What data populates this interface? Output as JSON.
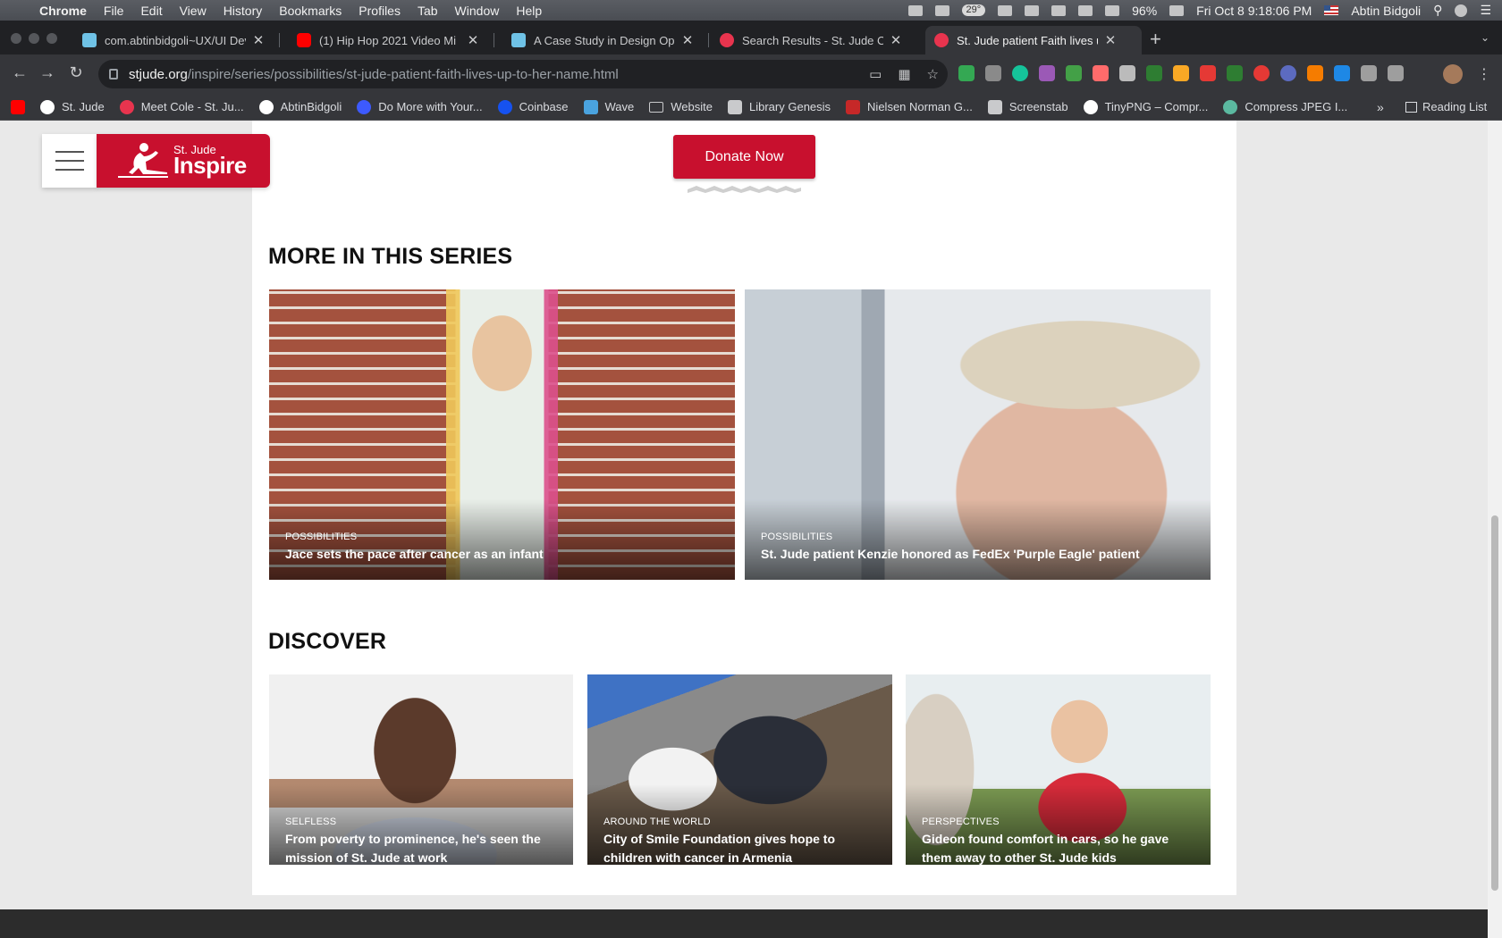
{
  "menubar": {
    "app": "Chrome",
    "items": [
      "File",
      "Edit",
      "View",
      "History",
      "Bookmarks",
      "Profiles",
      "Tab",
      "Window",
      "Help"
    ],
    "temperature": "29°",
    "battery": "96%",
    "datetime": "Fri Oct 8  9:18:06 PM",
    "user": "Abtin Bidgoli"
  },
  "tabs": [
    {
      "title": "com.abtinbidgoli~UX/UI Devel",
      "favicon": "site-icon",
      "color": "#6fc2e6"
    },
    {
      "title": "(1) Hip Hop 2021 Video Mi",
      "favicon": "youtube-icon",
      "color": "#ff0000"
    },
    {
      "title": "A Case Study in Design Operat",
      "favicon": "site-icon",
      "color": "#6fc2e6"
    },
    {
      "title": "Search Results - St. Jude Chil",
      "favicon": "st-jude-icon",
      "color": "#e8344e"
    },
    {
      "title": "St. Jude patient Faith lives up t",
      "favicon": "st-jude-icon",
      "color": "#e8344e"
    }
  ],
  "address": {
    "domain": "stjude.org",
    "path": "/inspire/series/possibilities/st-jude-patient-faith-lives-up-to-her-name.html"
  },
  "bookmarks": [
    {
      "label": "",
      "favicon": "youtube-icon",
      "color": "#ff0000"
    },
    {
      "label": "St. Jude",
      "favicon": "st-jude-icon",
      "color": "#ffffff"
    },
    {
      "label": "Meet Cole - St. Ju...",
      "favicon": "st-jude-icon",
      "color": "#e8344e"
    },
    {
      "label": "AbtinBidgoli",
      "favicon": "github-icon",
      "color": "#ffffff"
    },
    {
      "label": "Do More with Your...",
      "favicon": "circle-icon",
      "color": "#3d5afe"
    },
    {
      "label": "Coinbase",
      "favicon": "coinbase-icon",
      "color": "#1652f0"
    },
    {
      "label": "Wave",
      "favicon": "wave-icon",
      "color": "#4aa3df"
    },
    {
      "label": "Website",
      "favicon": "folder-icon",
      "color": "#c9cacc"
    },
    {
      "label": "Library Genesis",
      "favicon": "book-icon",
      "color": "#c9cacc"
    },
    {
      "label": "Nielsen Norman G...",
      "favicon": "nng-icon",
      "color": "#c62828"
    },
    {
      "label": "Screenstab",
      "favicon": "cursor-icon",
      "color": "#c9cacc"
    },
    {
      "label": "TinyPNG – Compr...",
      "favicon": "panda-icon",
      "color": "#ffffff"
    },
    {
      "label": "Compress JPEG I...",
      "favicon": "leaf-icon",
      "color": "#5bb9a0"
    }
  ],
  "bookmarks_more": "»",
  "reading_list": "Reading List",
  "logo": {
    "line1": "St. Jude",
    "line2": "Inspire"
  },
  "donate_label": "Donate Now",
  "series_title": "MORE IN THIS SERIES",
  "series_cards": [
    {
      "category": "POSSIBILITIES",
      "title": "Jace sets the pace after cancer as an infant"
    },
    {
      "category": "POSSIBILITIES",
      "title": "St. Jude patient Kenzie honored as FedEx 'Purple Eagle' patient"
    }
  ],
  "discover_title": "DISCOVER",
  "discover_cards": [
    {
      "category": "SELFLESS",
      "title": "From poverty to prominence, he's seen the mission of St. Jude at work"
    },
    {
      "category": "AROUND THE WORLD",
      "title": "City of Smile Foundation gives hope to children with cancer in Armenia"
    },
    {
      "category": "PERSPECTIVES",
      "title": "Gideon found comfort in cars, so he gave them away to other St. Jude kids"
    }
  ],
  "colors": {
    "brand_red": "#c8102e",
    "chrome_dark": "#202124",
    "chrome_toolbar": "#35363a"
  }
}
